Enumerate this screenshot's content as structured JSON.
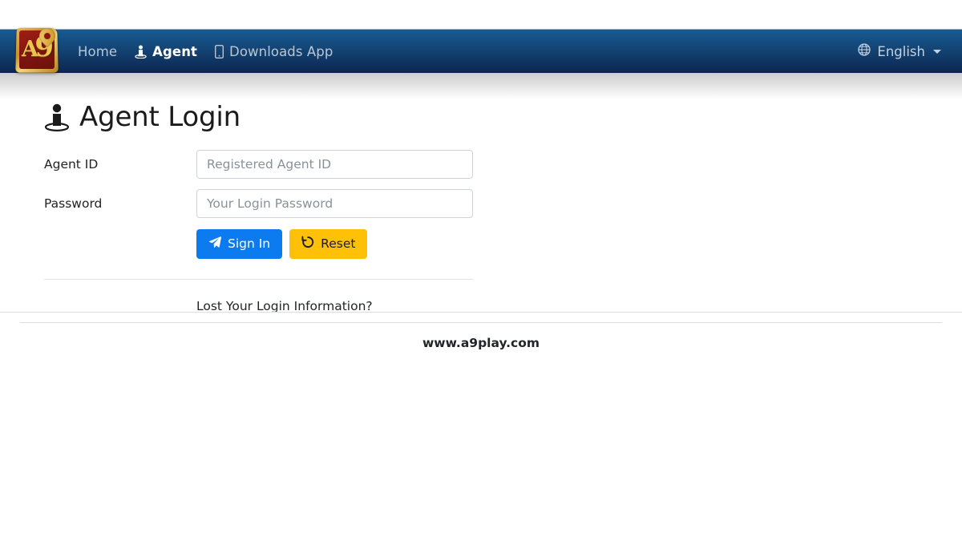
{
  "navbar": {
    "logo_alt": "A9 logo",
    "logo_letter": "A",
    "logo_digit": "9",
    "links": [
      {
        "label": "Home",
        "icon": "",
        "active": false
      },
      {
        "label": "Agent",
        "icon": "user-on-platform-icon",
        "active": true
      },
      {
        "label": "Downloads App",
        "icon": "mobile-phone-icon",
        "active": false
      }
    ],
    "language": {
      "label": "English",
      "icon": "globe-icon"
    },
    "colors": {
      "gradient_top": "#1a5b94",
      "gradient_bottom": "#0c2550",
      "link_muted": "#b9c6d4",
      "link_active": "#ffffff"
    }
  },
  "page": {
    "title": "Agent Login",
    "title_icon": "user-on-platform-icon"
  },
  "form": {
    "fields": [
      {
        "label": "Agent ID",
        "placeholder": "Registered Agent ID",
        "value": "",
        "type": "text"
      },
      {
        "label": "Password",
        "placeholder": "Your Login Password",
        "value": "",
        "type": "password"
      }
    ],
    "buttons": {
      "submit": {
        "label": "Sign In",
        "icon": "paper-plane-icon",
        "color": "#0d7bf0"
      },
      "reset": {
        "label": "Reset",
        "icon": "undo-arrow-icon",
        "color": "#ffc107"
      }
    },
    "lost_login_label": "Lost Your Login Information?"
  },
  "footer": {
    "site": "www.a9play.com"
  }
}
